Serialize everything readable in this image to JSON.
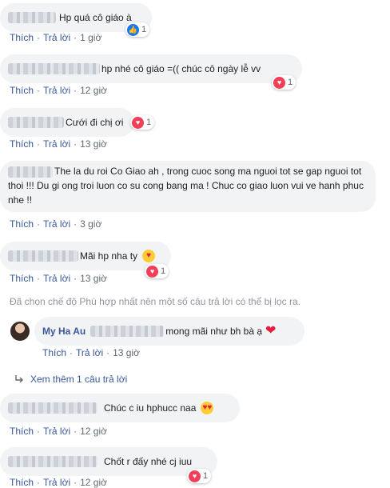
{
  "labels": {
    "like": "Thích",
    "reply": "Trả lời",
    "sep": "·"
  },
  "colors": {
    "link": "#385898",
    "bubble": "#f2f3f5",
    "love": "#f33e58",
    "like": "#1877f2"
  },
  "comments": [
    {
      "text": "Hp quá cô giáo à",
      "time": "1 giờ",
      "reaction": {
        "type": "like-icon",
        "count": "1"
      }
    },
    {
      "text": "hp nhé cô giáo =(( chúc cô ngày lễ vv",
      "time": "12 giờ",
      "reaction": {
        "type": "love-icon",
        "count": "1"
      }
    },
    {
      "text": "Cưới đi chị ơi",
      "time": "13 giờ",
      "reaction": {
        "type": "love-icon",
        "count": "1"
      }
    },
    {
      "text": "The la du roi Co Giao ah , trong cuoc song ma nguoi tot se gap nguoi tot thoi !!! Du gi ong troi luon co su cong bang ma ! Chuc co giao luon vui ve hanh phuc nhe !!",
      "time": "3 giờ"
    },
    {
      "text": "Mãi hp nha ty",
      "emoji": "smiling-hearts-icon",
      "time": "13 giờ",
      "reaction": {
        "type": "love-icon",
        "count": "1"
      }
    },
    {
      "text": "Chúc c iu hphucc naa",
      "emoji": "heart-eyes-icon",
      "time": "12 giờ"
    },
    {
      "text": "Chốt r đấy nhé cj iuu",
      "time": "12 giờ",
      "reaction": {
        "type": "love-icon",
        "count": "1"
      }
    }
  ],
  "filter_note": "Đã chọn chế độ Phù hợp nhất nên một số câu trả lời có thể bị lọc ra.",
  "reply": {
    "author": "My Ha Au",
    "text": "mong mãi như bh bà ạ",
    "time": "13 giờ"
  },
  "more_replies": "Xem thêm 1 câu trả lời"
}
